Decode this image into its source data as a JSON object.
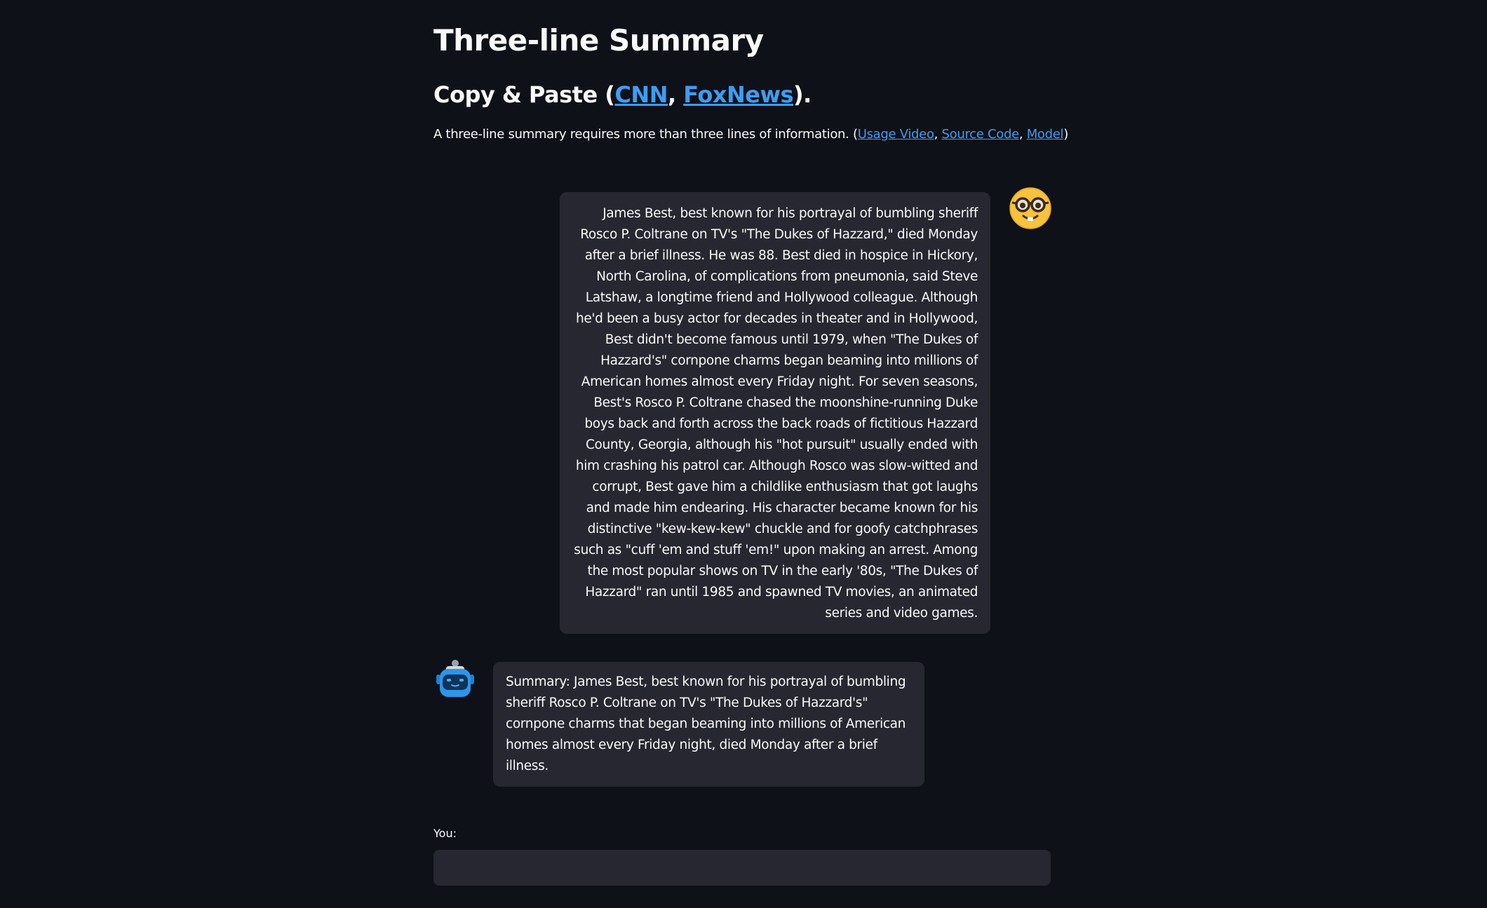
{
  "header": {
    "title": "Three-line Summary",
    "subtitle_prefix": "Copy & Paste (",
    "subtitle_link_cnn": "CNN",
    "subtitle_sep": ", ",
    "subtitle_link_foxnews": "FoxNews",
    "subtitle_suffix": ")."
  },
  "description": {
    "text": "A three-line summary requires more than three lines of information. (",
    "link_usage_video": "Usage Video",
    "sep1": ", ",
    "link_source_code": "Source Code",
    "sep2": ", ",
    "link_model": "Model",
    "suffix": ")"
  },
  "messages": [
    {
      "role": "user",
      "avatar_icon": "nerd-face-icon",
      "text": "James Best, best known for his portrayal of bumbling sheriff Rosco P. Coltrane on TV's \"The Dukes of Hazzard,\" died Monday after a brief illness. He was 88. Best died in hospice in Hickory, North Carolina, of complications from pneumonia, said Steve Latshaw, a longtime friend and Hollywood colleague. Although he'd been a busy actor for decades in theater and in Hollywood, Best didn't become famous until 1979, when \"The Dukes of Hazzard's\" cornpone charms began beaming into millions of American homes almost every Friday night. For seven seasons, Best's Rosco P. Coltrane chased the moonshine-running Duke boys back and forth across the back roads of fictitious Hazzard County, Georgia, although his \"hot pursuit\" usually ended with him crashing his patrol car. Although Rosco was slow-witted and corrupt, Best gave him a childlike enthusiasm that got laughs and made him endearing. His character became known for his distinctive \"kew-kew-kew\" chuckle and for goofy catchphrases such as \"cuff 'em and stuff 'em!\" upon making an arrest. Among the most popular shows on TV in the early '80s, \"The Dukes of Hazzard\" ran until 1985 and spawned TV movies, an animated series and video games."
    },
    {
      "role": "bot",
      "avatar_icon": "robot-icon",
      "text": "Summary: James Best, best known for his portrayal of bumbling sheriff Rosco P. Coltrane on TV's \"The Dukes of Hazzard's\" cornpone charms that began beaming into millions of American homes almost every Friday night, died Monday after a brief illness."
    }
  ],
  "input": {
    "label": "You:",
    "value": "",
    "placeholder": ""
  },
  "colors": {
    "background": "#0e1117",
    "bubble": "#262730",
    "link": "#3d9df3",
    "text": "#fafafa"
  }
}
